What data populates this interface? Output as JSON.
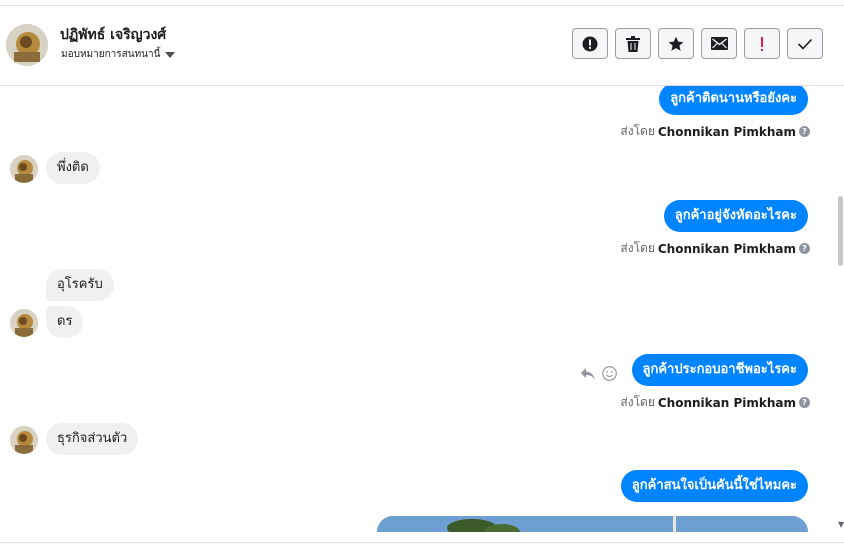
{
  "header": {
    "name": "ปฏิพัทธ์ เจริญวงศ์",
    "assign_label": "มอบหมายการสนทนานี้",
    "actions": [
      {
        "name": "spam-button",
        "icon": "alert-circle-icon"
      },
      {
        "name": "delete-button",
        "icon": "trash-icon"
      },
      {
        "name": "star-button",
        "icon": "star-icon"
      },
      {
        "name": "mark-unread-button",
        "icon": "envelope-icon"
      },
      {
        "name": "important-button",
        "icon": "exclamation-icon"
      },
      {
        "name": "done-button",
        "icon": "check-icon"
      }
    ]
  },
  "messages": {
    "out1": "ลูกค้าติดนานหรือยังคะ",
    "sent_prefix": "ส่งโดย",
    "sender": "Chonnikan Pimkham",
    "in1": "พึ่งติด",
    "out2": "ลูกค้าอยู่จังหัดอะไรคะ",
    "in2": "อุโรครับ",
    "in3": "ดร",
    "out3": "ลูกค้าประกอบอาชีพอะไรคะ",
    "in4": "ธุรกิจส่วนตัว",
    "out4": "ลูกค้าสนใจเป็นคันนี้ใช่ไหมคะ"
  },
  "colors": {
    "outgoing": "#0084ff",
    "incoming": "#f1f0f0",
    "important": "#e41e3f"
  }
}
